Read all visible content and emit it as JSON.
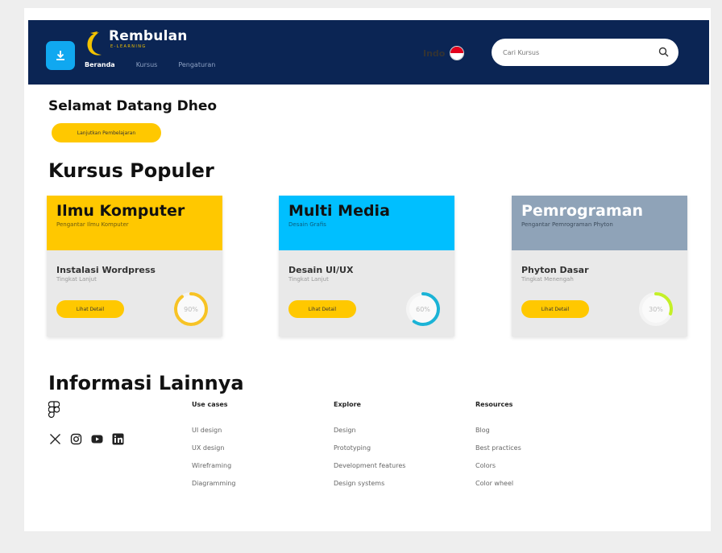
{
  "brand": {
    "name": "Rembulan",
    "tagline": "E-LEARNING"
  },
  "nav": {
    "items": [
      "Beranda",
      "Kursus",
      "Pengaturan"
    ]
  },
  "language": {
    "label": "Indo"
  },
  "search": {
    "placeholder": "Cari Kursus"
  },
  "welcome": {
    "title": "Selamat Datang Dheo",
    "continue_label": "Lanjutkan Pembelajaran"
  },
  "popular": {
    "title": "Kursus Populer",
    "courses": [
      {
        "title": "Ilmu Komputer",
        "subtitle": "Pengantar Ilmu Komputer",
        "lesson": "Instalasi Wordpress",
        "level": "Tingkat Lanjut",
        "button": "Lihat Detail",
        "progress_label": "90%",
        "progress": 0.9,
        "color": "#ffc800",
        "ring": "#f7c325"
      },
      {
        "title": "Multi Media",
        "subtitle": "Desain Grafis",
        "lesson": "Desain UI/UX",
        "level": "Tingkat Lanjut",
        "button": "Lihat Detail",
        "progress_label": "60%",
        "progress": 0.6,
        "color": "#00bfff",
        "ring": "#1bb3d6"
      },
      {
        "title": "Pemrograman",
        "subtitle": "Pengantar Pemrograman Phyton",
        "lesson": "Phyton Dasar",
        "level": "Tingkat Menengah",
        "button": "Lihat Detail",
        "progress_label": "30%",
        "progress": 0.3,
        "color": "#8fa3b8",
        "ring": "#c4f028"
      }
    ]
  },
  "footer": {
    "title": "Informasi Lainnya",
    "columns": [
      {
        "heading": "Use cases",
        "items": [
          "UI design",
          "UX design",
          "Wireframing",
          "Diagramming"
        ]
      },
      {
        "heading": "Explore",
        "items": [
          "Design",
          "Prototyping",
          "Development features",
          "Design systems"
        ]
      },
      {
        "heading": "Resources",
        "items": [
          "Blog",
          "Best practices",
          "Colors",
          "Color wheel"
        ]
      }
    ]
  },
  "colors": {
    "header": "#0b2554",
    "accent": "#ffc800",
    "app_button": "#10a8f0"
  },
  "icons": [
    "download-icon",
    "search-icon",
    "flag-icon",
    "figma-icon",
    "x-icon",
    "instagram-icon",
    "youtube-icon",
    "linkedin-icon"
  ]
}
